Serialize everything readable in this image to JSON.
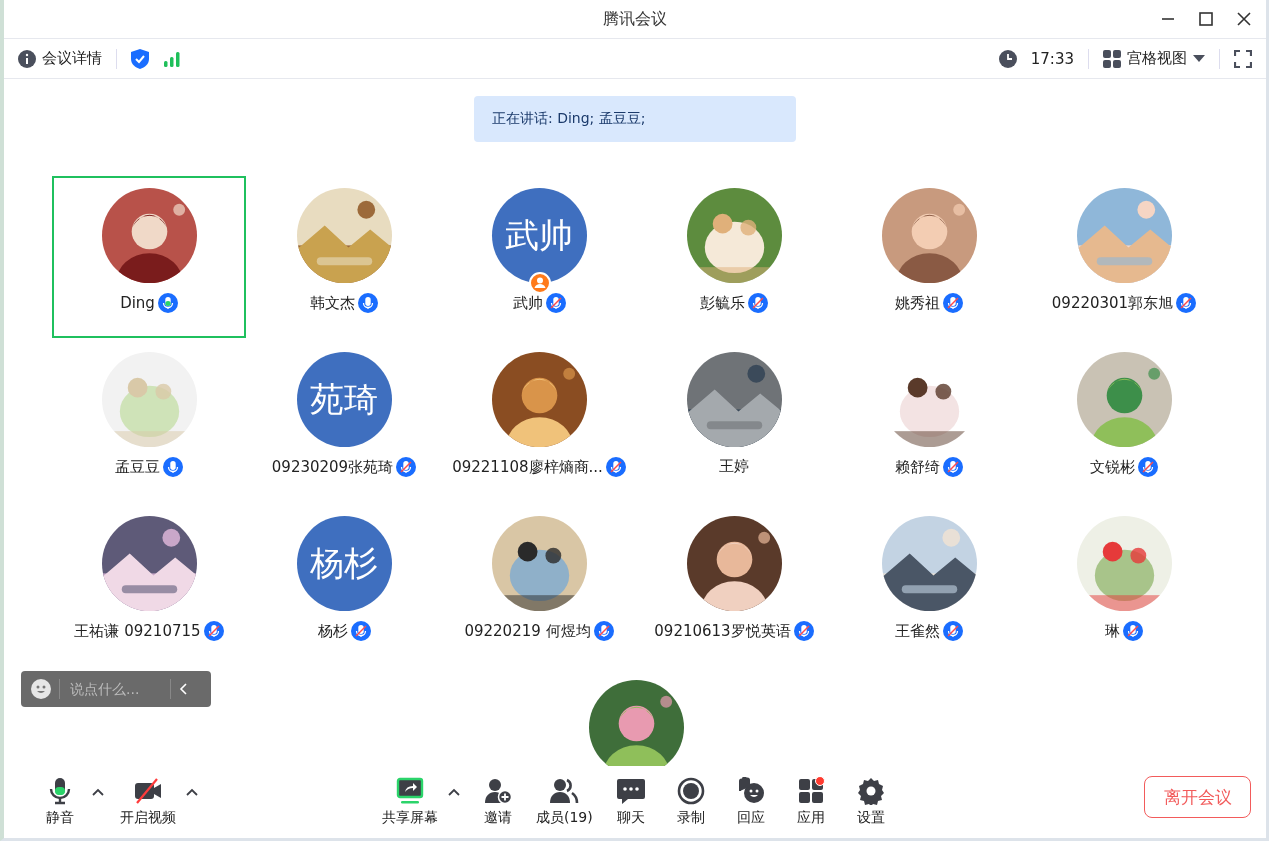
{
  "window": {
    "title": "腾讯会议"
  },
  "info_bar": {
    "details": "会议详情",
    "time": "17:33",
    "view": "宫格视图"
  },
  "speaking_banner": "正在讲话: Ding; 孟豆豆;",
  "participants": [
    {
      "name": "Ding",
      "mic": true,
      "muted": false,
      "speaking": true,
      "selected": true,
      "host": false
    },
    {
      "name": "韩文杰",
      "mic": true,
      "muted": false,
      "speaking": false,
      "selected": false,
      "host": false
    },
    {
      "name": "武帅",
      "mic": true,
      "muted": true,
      "speaking": false,
      "selected": false,
      "host": true,
      "avatar": {
        "kind": "text",
        "text": "武帅"
      }
    },
    {
      "name": "彭毓乐",
      "mic": true,
      "muted": true,
      "speaking": false,
      "selected": false,
      "host": false
    },
    {
      "name": "姚秀祖",
      "mic": true,
      "muted": true,
      "speaking": false,
      "selected": false,
      "host": false
    },
    {
      "name": "09220301郭东旭",
      "mic": true,
      "muted": true,
      "speaking": false,
      "selected": false,
      "host": false
    },
    {
      "name": "孟豆豆",
      "mic": true,
      "muted": false,
      "speaking": false,
      "selected": false,
      "host": false
    },
    {
      "name": "09230209张苑琦",
      "mic": true,
      "muted": true,
      "speaking": false,
      "selected": false,
      "host": false,
      "avatar": {
        "kind": "text",
        "text": "苑琦"
      }
    },
    {
      "name": "09221108廖梓熵商...",
      "mic": true,
      "muted": true,
      "speaking": false,
      "selected": false,
      "host": false
    },
    {
      "name": "王婷",
      "mic": false,
      "selected": false,
      "host": false
    },
    {
      "name": "赖舒绮",
      "mic": true,
      "muted": true,
      "speaking": false,
      "selected": false,
      "host": false
    },
    {
      "name": "文锐彬",
      "mic": true,
      "muted": true,
      "speaking": false,
      "selected": false,
      "host": false
    },
    {
      "name": "王祐谦 09210715",
      "mic": true,
      "muted": true,
      "speaking": false,
      "selected": false,
      "host": false
    },
    {
      "name": "杨杉",
      "mic": true,
      "muted": true,
      "speaking": false,
      "selected": false,
      "host": false,
      "avatar": {
        "kind": "text",
        "text": "杨杉"
      }
    },
    {
      "name": "09220219 何煜均",
      "mic": true,
      "muted": true,
      "speaking": false,
      "selected": false,
      "host": false
    },
    {
      "name": "09210613罗悦英语",
      "mic": true,
      "muted": true,
      "speaking": false,
      "selected": false,
      "host": false
    },
    {
      "name": "王雀然",
      "mic": true,
      "muted": true,
      "speaking": false,
      "selected": false,
      "host": false
    },
    {
      "name": "琳",
      "mic": true,
      "muted": true,
      "speaking": false,
      "selected": false,
      "host": false
    },
    {
      "selected": false
    }
  ],
  "chat_box": {
    "placeholder": "说点什么..."
  },
  "toolbar": {
    "left": [
      {
        "label": "静音",
        "kind": "mic",
        "caret": true
      },
      {
        "label": "开启视频",
        "kind": "camera",
        "caret": true
      }
    ],
    "center": [
      {
        "label": "共享屏幕",
        "kind": "share",
        "caret": true
      },
      {
        "label": "邀请",
        "kind": "invite",
        "caret": false
      },
      {
        "label": "成员(19)",
        "kind": "members",
        "caret": false
      },
      {
        "label": "聊天",
        "kind": "chat",
        "caret": false
      },
      {
        "label": "录制",
        "kind": "record",
        "caret": false
      },
      {
        "label": "回应",
        "kind": "react",
        "caret": false
      },
      {
        "label": "应用",
        "kind": "apps",
        "caret": false
      },
      {
        "label": "设置",
        "kind": "settings",
        "caret": false
      }
    ]
  },
  "leave_button": "离开会议"
}
